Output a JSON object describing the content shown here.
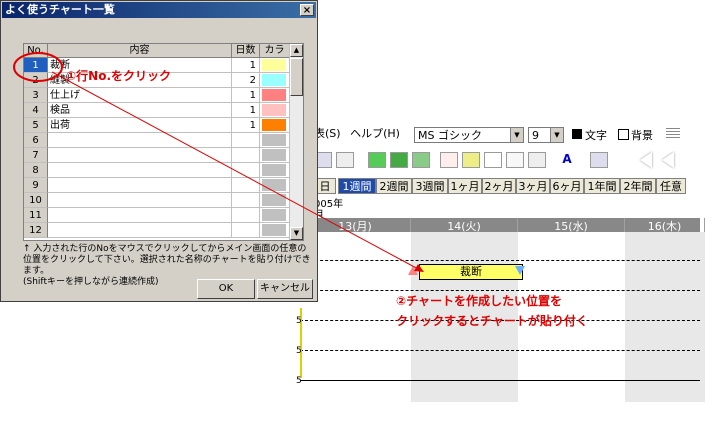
{
  "dialog": {
    "title": "よく使うチャート一覧",
    "close": "×",
    "columns": [
      "No.",
      "内容",
      "日数",
      "カラー"
    ],
    "rows": [
      {
        "no": "1",
        "name": "裁断",
        "days": "1",
        "color": "#ffff99"
      },
      {
        "no": "2",
        "name": "縫製",
        "days": "2",
        "color": "#99ffff"
      },
      {
        "no": "3",
        "name": "仕上げ",
        "days": "1",
        "color": "#ff8080"
      },
      {
        "no": "4",
        "name": "検品",
        "days": "1",
        "color": "#ffc0c0"
      },
      {
        "no": "5",
        "name": "出荷",
        "days": "1",
        "color": "#ff8000"
      },
      {
        "no": "6",
        "name": "",
        "days": "",
        "color": "#c0c0c0"
      },
      {
        "no": "7",
        "name": "",
        "days": "",
        "color": "#c0c0c0"
      },
      {
        "no": "8",
        "name": "",
        "days": "",
        "color": "#c0c0c0"
      },
      {
        "no": "9",
        "name": "",
        "days": "",
        "color": "#c0c0c0"
      },
      {
        "no": "10",
        "name": "",
        "days": "",
        "color": "#c0c0c0"
      },
      {
        "no": "11",
        "name": "",
        "days": "",
        "color": "#c0c0c0"
      },
      {
        "no": "12",
        "name": "",
        "days": "",
        "color": "#c0c0c0"
      }
    ],
    "instruction_mark": "↑",
    "instruction_1": "入力された行のNoをマウスでクリックしてからメイン画面の任意の位置をクリックして下さい。選択された名称のチャートを貼り付けできます。",
    "instruction_2": "(Shiftキーを押しながら連続作成)",
    "ok": "OK",
    "cancel": "キャンセル"
  },
  "app": {
    "menu": [
      "表(S)",
      "ヘルプ(H)"
    ],
    "font": "MS ゴシック",
    "size": "9",
    "text_label": "文字",
    "bg_label": "背景",
    "ranges": [
      "日",
      "1週間",
      "2週間",
      "3週間",
      "1ヶ月",
      "2ヶ月",
      "3ヶ月",
      "6ヶ月",
      "1年間",
      "2年間",
      "任意"
    ],
    "year": "005年",
    "month": "月",
    "days": [
      "13(月)",
      "14(火)",
      "15(水)",
      "16(木)"
    ],
    "chart_label": "裁断",
    "row_marker": "5"
  },
  "callouts": {
    "step1": "①行No.をクリック",
    "step2_line1": "②チャートを作成したい位置を",
    "step2_line2": "クリックするとチャートが貼り付く"
  },
  "colors": {
    "accent": "#e00000",
    "selection": "#1f5fbf",
    "chart_bar": "#ffff66"
  }
}
